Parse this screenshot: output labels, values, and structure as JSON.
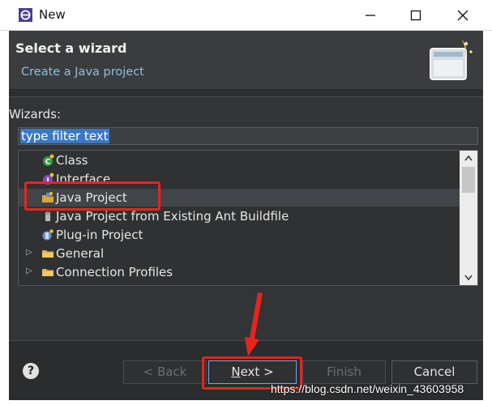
{
  "window": {
    "title": "New"
  },
  "header": {
    "title": "Select a wizard",
    "subtitle": "Create a Java project"
  },
  "wizards": {
    "label": "Wizards:",
    "filter_value": "type filter text"
  },
  "tree": {
    "items": [
      {
        "label": "Class",
        "icon": "class-icon",
        "expandable": false
      },
      {
        "label": "Interface",
        "icon": "interface-icon",
        "expandable": false
      },
      {
        "label": "Java Project",
        "icon": "java-project-icon",
        "expandable": false,
        "selected": true
      },
      {
        "label": "Java Project from Existing Ant Buildfile",
        "icon": "ant-buildfile-icon",
        "expandable": false
      },
      {
        "label": "Plug-in Project",
        "icon": "plugin-project-icon",
        "expandable": false
      },
      {
        "label": "General",
        "icon": "folder-icon",
        "expandable": true
      },
      {
        "label": "Connection Profiles",
        "icon": "folder-icon",
        "expandable": true
      }
    ]
  },
  "buttons": {
    "back": "< Back",
    "next_mnemonic": "N",
    "next_rest": "ext >",
    "finish": "Finish",
    "cancel": "Cancel",
    "help": "?"
  },
  "watermark": "https://blog.csdn.net/weixin_43603958",
  "colors": {
    "accent": "#3b78c4",
    "highlight": "#e8241c",
    "subtitle": "#8fbfdc"
  }
}
